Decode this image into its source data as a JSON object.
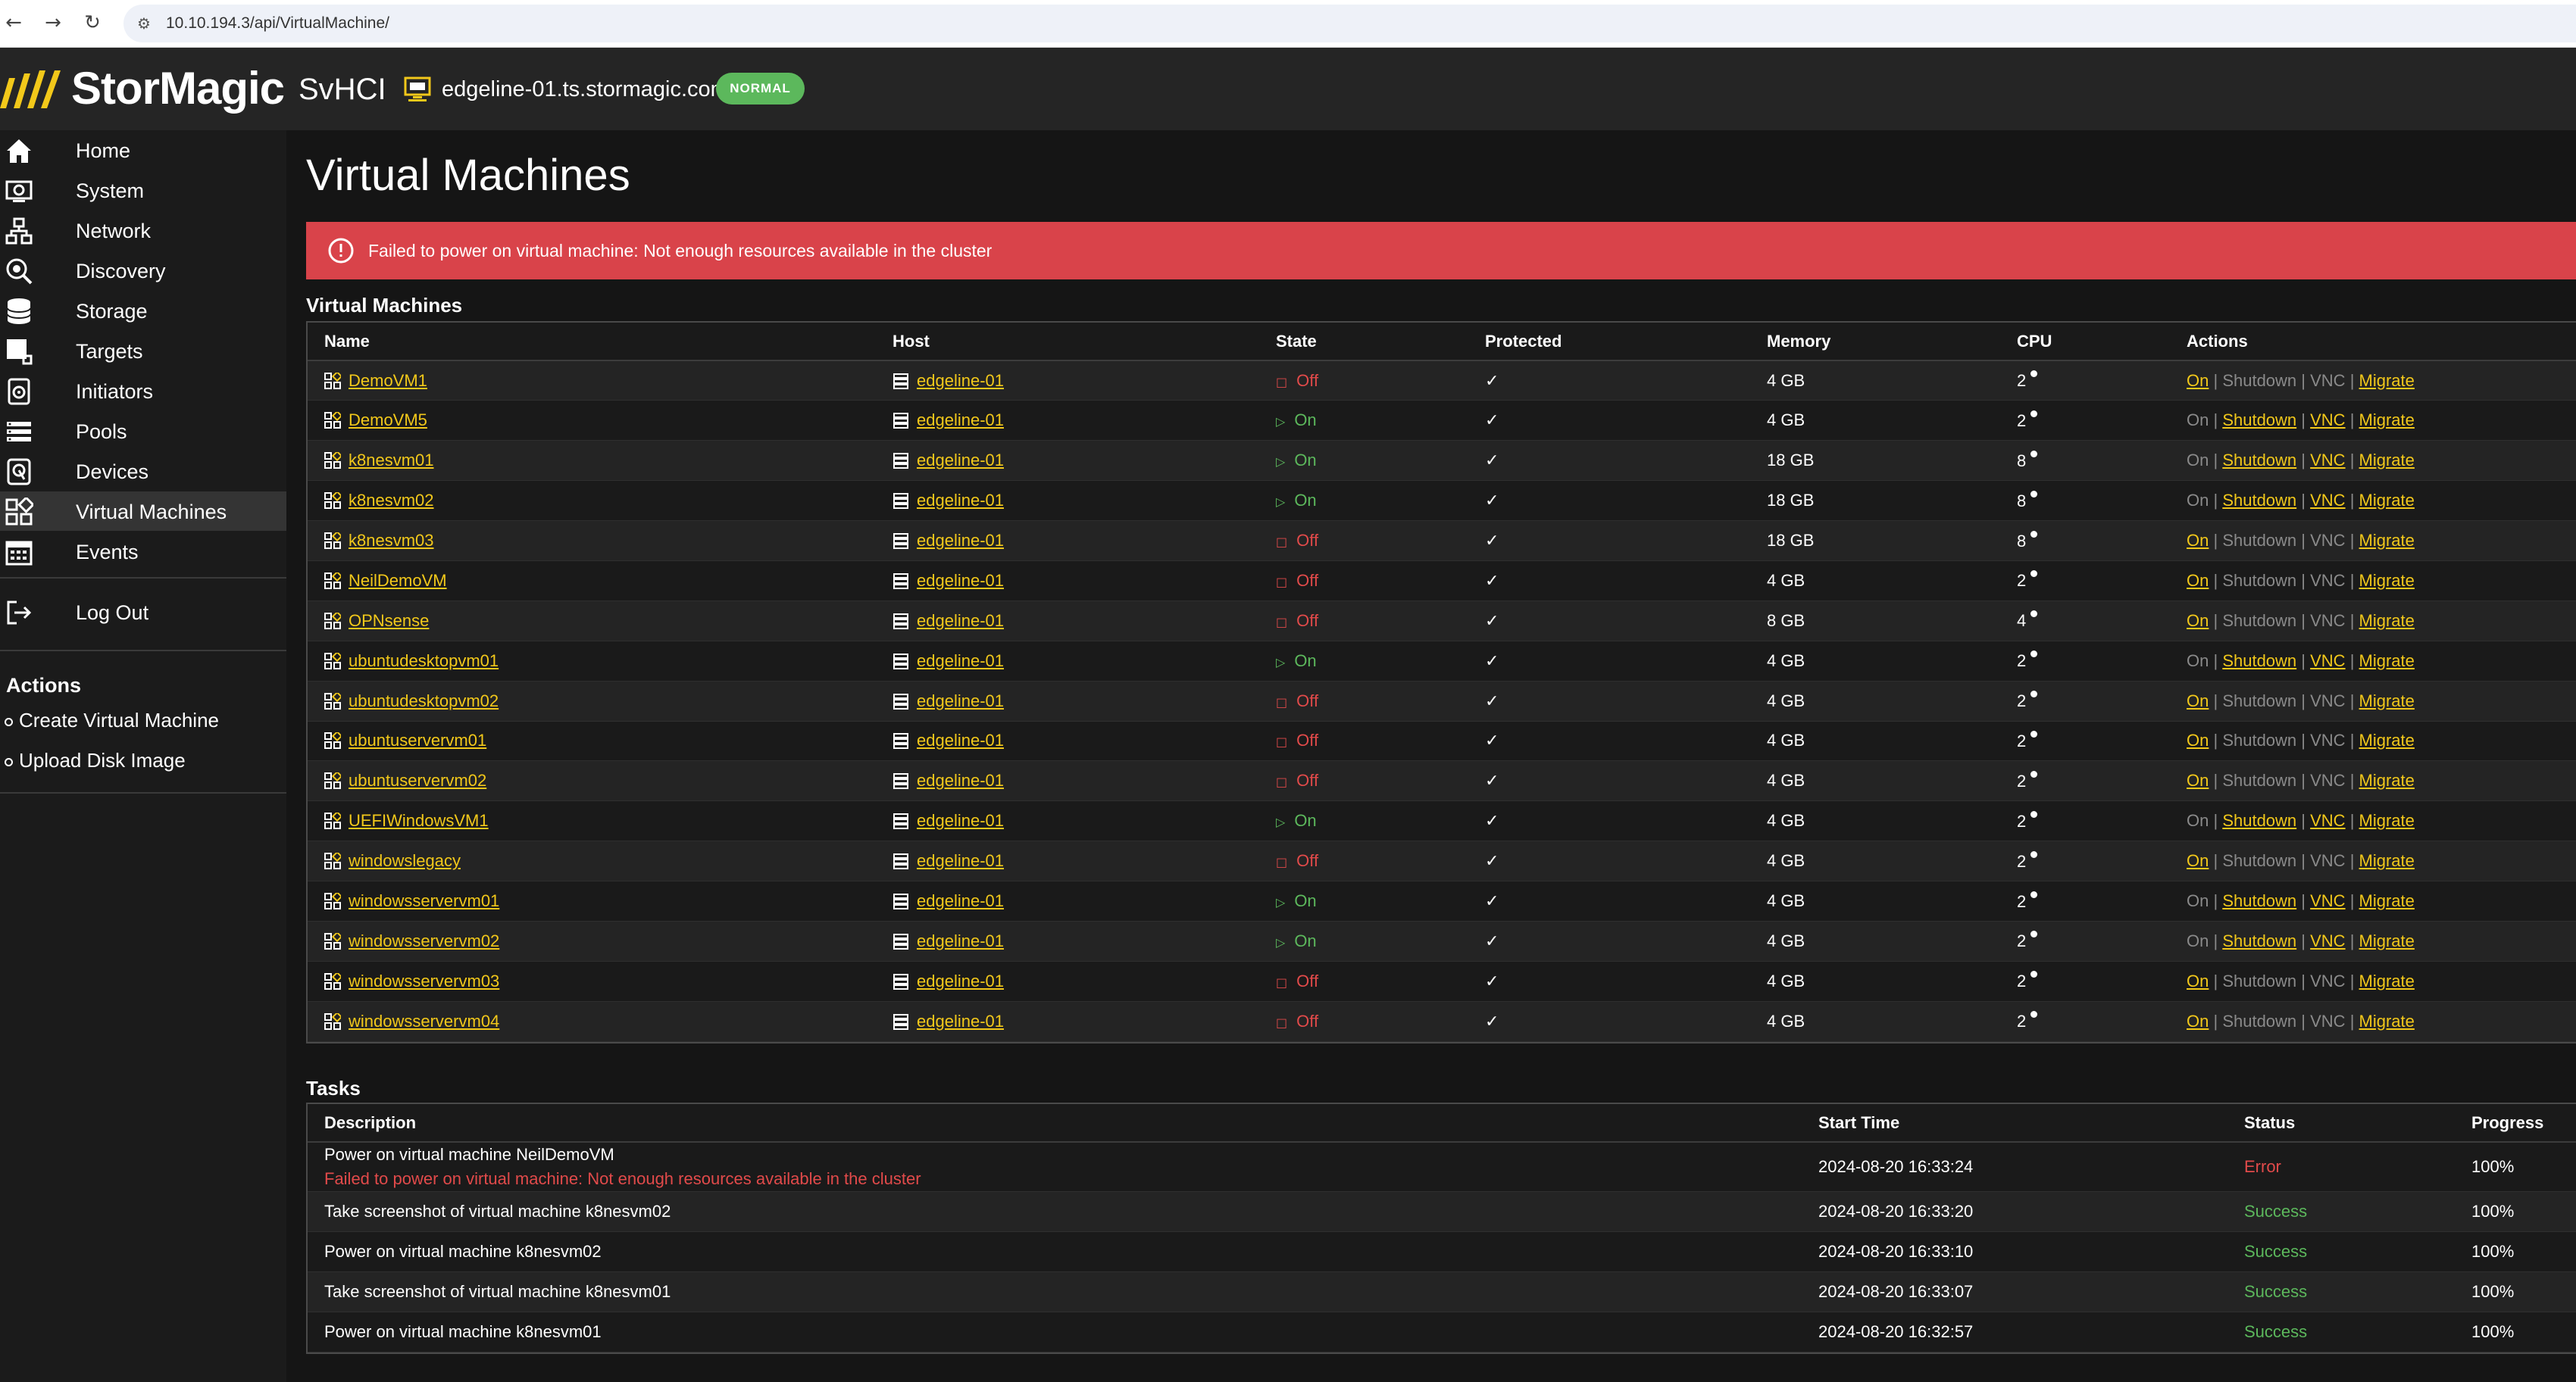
{
  "browser": {
    "back_icon": "arrow-left-icon",
    "forward_icon": "arrow-right-icon",
    "reload_icon": "reload-icon",
    "url": "10.10.194.3/api/VirtualMachine/"
  },
  "header": {
    "brand": "StorMagic",
    "product": "SvHCI",
    "hostname": "edgeline-01.ts.stormagic.com",
    "mode_badge": "NORMAL",
    "colors": {
      "accent": "#f2c81a",
      "badge": "#5cb85c",
      "header_bg": "#252525"
    }
  },
  "sidebar": {
    "items": [
      {
        "label": "Home",
        "icon": "home-icon"
      },
      {
        "label": "System",
        "icon": "system-icon"
      },
      {
        "label": "Network",
        "icon": "network-icon"
      },
      {
        "label": "Discovery",
        "icon": "discovery-icon"
      },
      {
        "label": "Storage",
        "icon": "storage-icon"
      },
      {
        "label": "Targets",
        "icon": "targets-icon"
      },
      {
        "label": "Initiators",
        "icon": "initiators-icon"
      },
      {
        "label": "Pools",
        "icon": "pools-icon"
      },
      {
        "label": "Devices",
        "icon": "devices-icon"
      },
      {
        "label": "Virtual Machines",
        "icon": "virtual-machines-icon",
        "active": true
      },
      {
        "label": "Events",
        "icon": "events-icon"
      }
    ],
    "logout": "Log Out",
    "actions_heading": "Actions",
    "actions": [
      "Create Virtual Machine",
      "Upload Disk Image"
    ]
  },
  "main": {
    "title": "Virtual Machines",
    "alert": "Failed to power on virtual machine: Not enough resources available in the cluster",
    "vm_section_title": "Virtual Machines",
    "vm_columns": [
      "Name",
      "Host",
      "State",
      "Protected",
      "Memory",
      "CPU",
      "Actions"
    ],
    "action_labels": {
      "on": "On",
      "shutdown": "Shutdown",
      "vnc": "VNC",
      "migrate": "Migrate"
    },
    "vms": [
      {
        "name": "DemoVM1",
        "host": "edgeline-01",
        "state": "Off",
        "memory": "4 GB",
        "cpu": "2"
      },
      {
        "name": "DemoVM5",
        "host": "edgeline-01",
        "state": "On",
        "memory": "4 GB",
        "cpu": "2"
      },
      {
        "name": "k8nesvm01",
        "host": "edgeline-01",
        "state": "On",
        "memory": "18 GB",
        "cpu": "8"
      },
      {
        "name": "k8nesvm02",
        "host": "edgeline-01",
        "state": "On",
        "memory": "18 GB",
        "cpu": "8"
      },
      {
        "name": "k8nesvm03",
        "host": "edgeline-01",
        "state": "Off",
        "memory": "18 GB",
        "cpu": "8"
      },
      {
        "name": "NeilDemoVM",
        "host": "edgeline-01",
        "state": "Off",
        "memory": "4 GB",
        "cpu": "2"
      },
      {
        "name": "OPNsense",
        "host": "edgeline-01",
        "state": "Off",
        "memory": "8 GB",
        "cpu": "4"
      },
      {
        "name": "ubuntudesktopvm01",
        "host": "edgeline-01",
        "state": "On",
        "memory": "4 GB",
        "cpu": "2"
      },
      {
        "name": "ubuntudesktopvm02",
        "host": "edgeline-01",
        "state": "Off",
        "memory": "4 GB",
        "cpu": "2"
      },
      {
        "name": "ubuntuservervm01",
        "host": "edgeline-01",
        "state": "Off",
        "memory": "4 GB",
        "cpu": "2"
      },
      {
        "name": "ubuntuservervm02",
        "host": "edgeline-01",
        "state": "Off",
        "memory": "4 GB",
        "cpu": "2"
      },
      {
        "name": "UEFIWindowsVM1",
        "host": "edgeline-01",
        "state": "On",
        "memory": "4 GB",
        "cpu": "2"
      },
      {
        "name": "windowslegacy",
        "host": "edgeline-01",
        "state": "Off",
        "memory": "4 GB",
        "cpu": "2"
      },
      {
        "name": "windowsservervm01",
        "host": "edgeline-01",
        "state": "On",
        "memory": "4 GB",
        "cpu": "2"
      },
      {
        "name": "windowsservervm02",
        "host": "edgeline-01",
        "state": "On",
        "memory": "4 GB",
        "cpu": "2"
      },
      {
        "name": "windowsservervm03",
        "host": "edgeline-01",
        "state": "Off",
        "memory": "4 GB",
        "cpu": "2"
      },
      {
        "name": "windowsservervm04",
        "host": "edgeline-01",
        "state": "Off",
        "memory": "4 GB",
        "cpu": "2"
      }
    ],
    "tasks_section_title": "Tasks",
    "task_columns": [
      "Description",
      "Start Time",
      "Status",
      "Progress"
    ],
    "tasks": [
      {
        "description": "Power on virtual machine NeilDemoVM",
        "error": "Failed to power on virtual machine: Not enough resources available in the cluster",
        "start": "2024-08-20 16:33:24",
        "status": "Error",
        "progress": "100%"
      },
      {
        "description": "Take screenshot of virtual machine k8nesvm02",
        "start": "2024-08-20 16:33:20",
        "status": "Success",
        "progress": "100%"
      },
      {
        "description": "Power on virtual machine k8nesvm02",
        "start": "2024-08-20 16:33:10",
        "status": "Success",
        "progress": "100%"
      },
      {
        "description": "Take screenshot of virtual machine k8nesvm01",
        "start": "2024-08-20 16:33:07",
        "status": "Success",
        "progress": "100%"
      },
      {
        "description": "Power on virtual machine k8nesvm01",
        "start": "2024-08-20 16:32:57",
        "status": "Success",
        "progress": "100%"
      }
    ]
  }
}
